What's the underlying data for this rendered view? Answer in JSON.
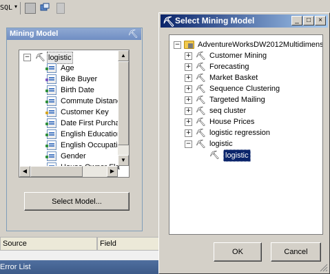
{
  "toolbar": {
    "sql_label": "SQL",
    "icons": [
      "dropdown-arrow-icon",
      "table-icon",
      "window-icon",
      "page-icon"
    ]
  },
  "mining_model_panel": {
    "title": "Mining Model",
    "root": "logistic",
    "columns": [
      {
        "label": "Age",
        "kind": "input-column"
      },
      {
        "label": "Bike Buyer",
        "kind": "predict-column"
      },
      {
        "label": "Birth Date",
        "kind": "input-column"
      },
      {
        "label": "Commute Distanc",
        "kind": "input-column"
      },
      {
        "label": "Customer Key",
        "kind": "key-column"
      },
      {
        "label": "Date First Purcha",
        "kind": "input-column"
      },
      {
        "label": "English Education",
        "kind": "input-column"
      },
      {
        "label": "English Occupatic",
        "kind": "input-column"
      },
      {
        "label": "Gender",
        "kind": "input-column"
      },
      {
        "label": "House Owner Fla",
        "kind": "input-column"
      }
    ],
    "select_button": "Select Model..."
  },
  "grid": {
    "source_header": "Source",
    "field_header": "Field"
  },
  "status_bar": {
    "text": "Error List"
  },
  "dialog": {
    "title": "Select Mining Model",
    "root": "AdventureWorksDW2012Multidimens",
    "structures": [
      {
        "label": "Customer Mining",
        "expanded": false
      },
      {
        "label": "Forecasting",
        "expanded": false
      },
      {
        "label": "Market Basket",
        "expanded": false
      },
      {
        "label": "Sequence Clustering",
        "expanded": false
      },
      {
        "label": "Targeted Mailing",
        "expanded": false
      },
      {
        "label": "seq cluster",
        "expanded": false
      },
      {
        "label": "House Prices",
        "expanded": false
      },
      {
        "label": "logistic regression",
        "expanded": false
      },
      {
        "label": "logistic",
        "expanded": true
      }
    ],
    "selected_model": "logistic",
    "ok_button": "OK",
    "cancel_button": "Cancel"
  },
  "colors": {
    "title_gradient_start": "#0a246a",
    "title_gradient_end": "#a6caf0",
    "selection": "#0a246a",
    "panel_header": "#7b96c8",
    "status_bar": "#3d5b88"
  }
}
